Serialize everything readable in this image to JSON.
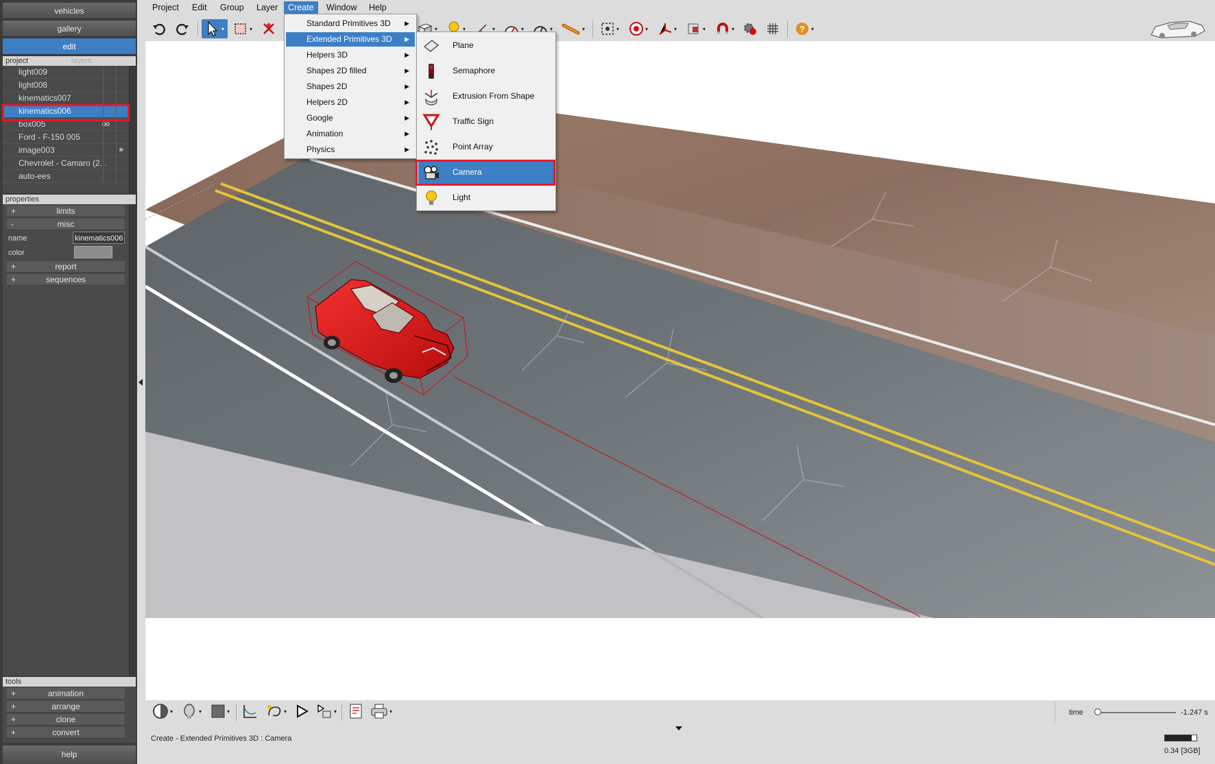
{
  "left_panel": {
    "nav": [
      "vehicles",
      "gallery",
      "edit"
    ],
    "tabs": {
      "project": "project",
      "layers": "layers"
    },
    "tree": [
      {
        "label": "light009",
        "badge": ""
      },
      {
        "label": "light008",
        "badge": ""
      },
      {
        "label": "kinematics007",
        "badge": ""
      },
      {
        "label": "kinematics006",
        "badge": "",
        "selected": true
      },
      {
        "label": "box005",
        "badge": "oo"
      },
      {
        "label": "Ford - F-150 005",
        "badge": ""
      },
      {
        "label": "image003",
        "badge": "✳"
      },
      {
        "label": "Chevrolet - Camaro (2...",
        "badge": ""
      },
      {
        "label": "auto-ees",
        "badge": ""
      }
    ],
    "properties": {
      "header": "properties",
      "limits": "limits",
      "misc": "misc",
      "name_label": "name",
      "name_value": "kinematics006",
      "color_label": "color",
      "report": "report",
      "sequences": "sequences"
    },
    "tools": {
      "header": "tools",
      "items": [
        "animation",
        "arrange",
        "clone",
        "convert"
      ]
    },
    "help": "help"
  },
  "menubar": [
    "Project",
    "Edit",
    "Group",
    "Layer",
    "Create",
    "Window",
    "Help"
  ],
  "create_menu": [
    "Standard Primitives 3D",
    "Extended Primitives 3D",
    "Helpers 3D",
    "Shapes 2D filled",
    "Shapes 2D",
    "Helpers 2D",
    "Google",
    "Animation",
    "Physics"
  ],
  "extended_menu": [
    {
      "label": "Plane",
      "icon": "plane-icon"
    },
    {
      "label": "Semaphore",
      "icon": "semaphore-icon"
    },
    {
      "label": "Extrusion From Shape",
      "icon": "extrusion-icon"
    },
    {
      "label": "Traffic Sign",
      "icon": "traffic-sign-icon"
    },
    {
      "label": "Point Array",
      "icon": "point-array-icon"
    },
    {
      "label": "Camera",
      "icon": "camera-icon"
    },
    {
      "label": "Light",
      "icon": "light-bulb-icon"
    }
  ],
  "status": {
    "message": "Create - Extended Primitives 3D : Camera",
    "time_label": "time",
    "time_value": "-1.247 s",
    "time_slider_fraction": 0.02,
    "memory": "0.34 [3GB]",
    "memory_fraction": 0.85
  },
  "colors": {
    "accent": "#3d7fc4",
    "highlight": "#e8192c",
    "car": "#e81c1c"
  }
}
